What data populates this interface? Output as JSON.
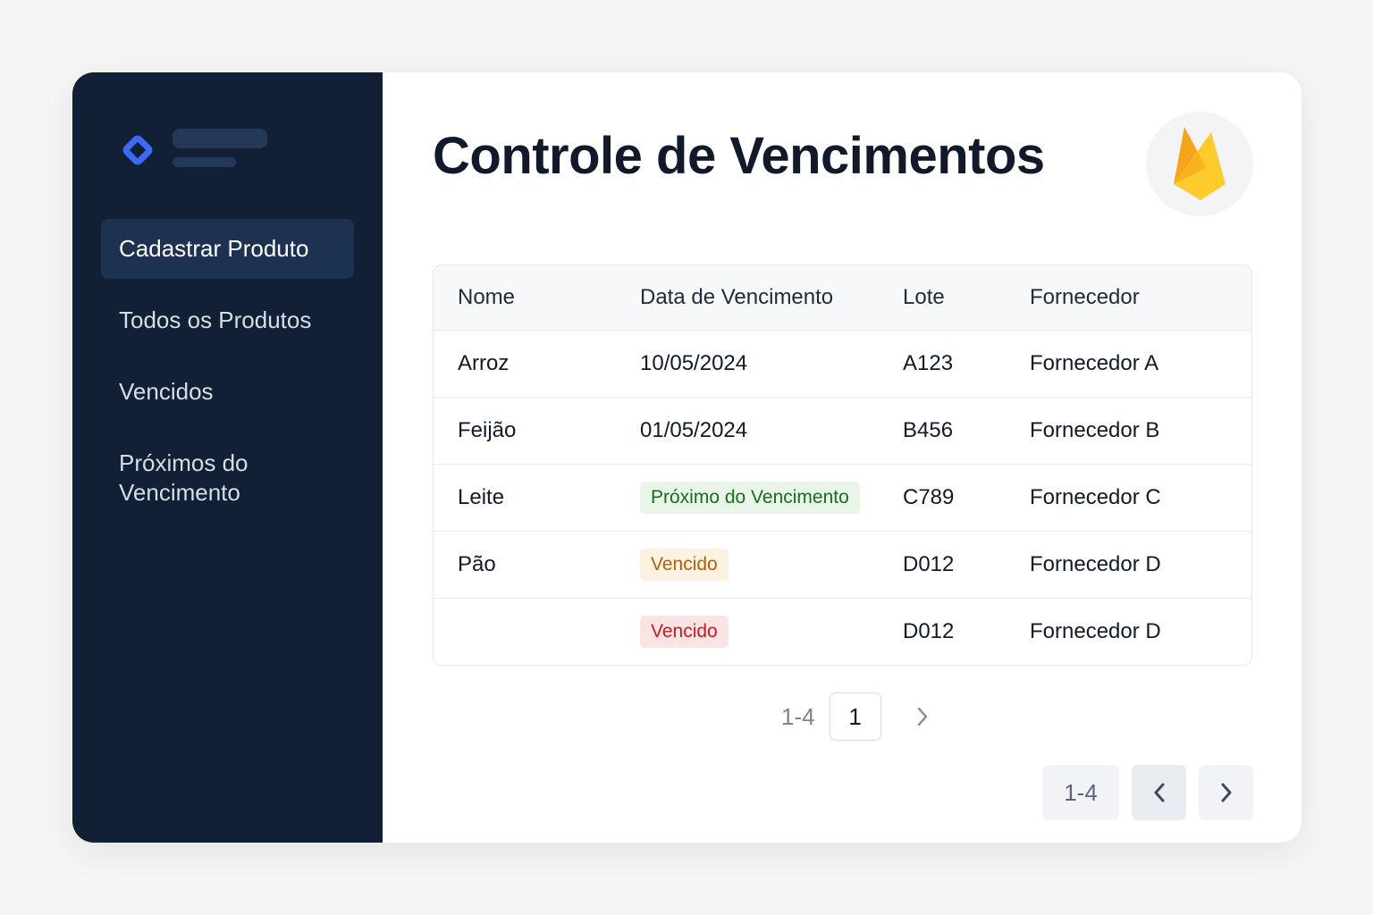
{
  "sidebar": {
    "items": [
      {
        "label": "Cadastrar Produto",
        "active": true
      },
      {
        "label": "Todos os Produtos",
        "active": false
      },
      {
        "label": "Vencidos",
        "active": false
      },
      {
        "label": "Próximos do Vencimento",
        "active": false
      }
    ]
  },
  "header": {
    "title": "Controle de Vencimentos",
    "badge_icon": "firebase-icon"
  },
  "table": {
    "columns": [
      "Nome",
      "Data de Vencimento",
      "Lote",
      "Fornecedor"
    ],
    "rows": [
      {
        "name": "Arroz",
        "date": "10/05/2024",
        "lot": "A123",
        "supplier": "Fornecedor A"
      },
      {
        "name": "Feijão",
        "date": "01/05/2024",
        "lot": "B456",
        "supplier": "Fornecedor B"
      },
      {
        "name": "Leite",
        "date": "Próximo do Vencimento",
        "date_badge": "green",
        "lot": "C789",
        "supplier": "Fornecedor C"
      },
      {
        "name": "Pão",
        "date": "Vencido",
        "date_badge": "orange",
        "lot": "D012",
        "supplier": "Fornecedor D"
      },
      {
        "name": "",
        "date": "Vencido",
        "date_badge": "red",
        "lot": "D012",
        "supplier": "Fornecedor D"
      }
    ]
  },
  "pagination": {
    "range": "1-4",
    "current_page": "1",
    "next_icon": "chevron-right-icon"
  },
  "bottom_pagination": {
    "range": "1-4",
    "prev_icon": "chevron-left-icon",
    "next_icon": "chevron-right-icon"
  },
  "colors": {
    "sidebar_bg": "#112034",
    "active_item_bg": "#1d3251",
    "logo_accent": "#3d6af2",
    "badge_green": "#1a6b1f",
    "badge_orange": "#b25f0c",
    "badge_red": "#c81c24"
  }
}
